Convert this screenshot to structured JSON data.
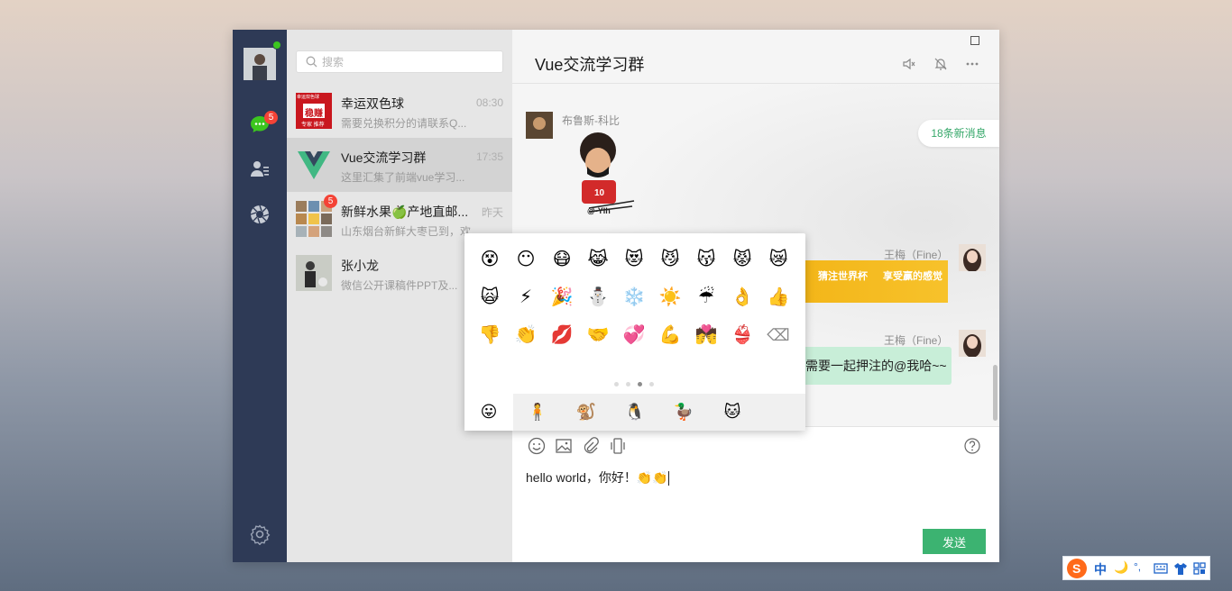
{
  "nav": {
    "chat_badge": "5"
  },
  "search": {
    "placeholder": "搜索"
  },
  "conversations": [
    {
      "name": "幸运双色球",
      "time": "08:30",
      "preview": "需要兑换积分的请联系Q...",
      "badge": ""
    },
    {
      "name": "Vue交流学习群",
      "time": "17:35",
      "preview": "这里汇集了前端vue学习...",
      "badge": ""
    },
    {
      "name": "新鲜水果🍏产地直邮...",
      "time": "昨天",
      "preview": "山东烟台新鲜大枣已到，欢",
      "badge": "5"
    },
    {
      "name": "张小龙",
      "time": "",
      "preview": "微信公开课稿件PPT及...",
      "badge": ""
    }
  ],
  "avatar_text": {
    "lucky_top": "幸运双色球",
    "lucky_mid": "稳赚",
    "lucky_bot": "专家 推荐"
  },
  "chat": {
    "title": "Vue交流学习群",
    "new_msgs": "18条新消息",
    "sender1": "布鲁斯-科比",
    "sticker_tag": "@-Ylh",
    "sender2": "王梅（Fine）",
    "sender3": "王梅（Fine）",
    "banner_left": "猜注世界杯",
    "banner_right": "享受赢的感觉",
    "bubble_text": "需要一起押注的@我哈~~"
  },
  "emoji": {
    "rows": [
      [
        "😵",
        "😶",
        "😷",
        "😹",
        "😻",
        "😼",
        "😽",
        "😾",
        "😿"
      ],
      [
        "🙀",
        "⚡",
        "🎉",
        "⛄",
        "❄️",
        "☀️",
        "☔",
        "👌",
        "👍"
      ],
      [
        "👎",
        "👏",
        "💋",
        "🤝",
        "💞",
        "💪",
        "💏",
        "👙",
        "⌫"
      ]
    ],
    "tabs": [
      "😛",
      "🧍",
      "🐒",
      "🐧",
      "🦆",
      "🐱"
    ]
  },
  "composer": {
    "text": "hello world，你好！👏👏"
  },
  "send_label": "发送",
  "ime": {
    "mode": "中",
    "moon": "🌙",
    "punct": "°,"
  }
}
